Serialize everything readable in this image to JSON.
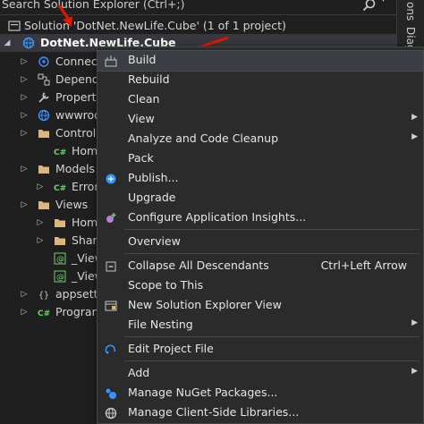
{
  "search": {
    "placeholder": "Search Solution Explorer (Ctrl+;)"
  },
  "dock": {
    "tabs": [
      "ons",
      "Diag"
    ]
  },
  "tree": {
    "solution": "Solution 'DotNet.NewLife.Cube' (1 of 1 project)",
    "project": "DotNet.NewLife.Cube",
    "items": [
      {
        "label": "Connect",
        "icon": "connected-services-icon"
      },
      {
        "label": "Depend",
        "icon": "dependencies-icon"
      },
      {
        "label": "Propert",
        "icon": "properties-icon"
      },
      {
        "label": "wwwroo",
        "icon": "globe-icon"
      },
      {
        "label": "Controll",
        "icon": "folder-icon"
      },
      {
        "label": "Hom",
        "icon": "csharp-file-icon"
      },
      {
        "label": "Models",
        "icon": "folder-icon"
      },
      {
        "label": "Error",
        "icon": "csharp-file-icon"
      },
      {
        "label": "Views",
        "icon": "folder-icon"
      },
      {
        "label": "Hom",
        "icon": "folder-icon"
      },
      {
        "label": "Share",
        "icon": "folder-icon"
      },
      {
        "label": "_View",
        "icon": "razor-file-icon"
      },
      {
        "label": "_View",
        "icon": "razor-file-icon"
      },
      {
        "label": "appsett",
        "icon": "json-file-icon"
      },
      {
        "label": "Program",
        "icon": "csharp-file-icon"
      }
    ]
  },
  "menu": {
    "items": [
      {
        "label": "Build",
        "icon": "build-icon",
        "highlighted": true
      },
      {
        "label": "Rebuild"
      },
      {
        "label": "Clean"
      },
      {
        "label": "View",
        "submenu": true
      },
      {
        "label": "Analyze and Code Cleanup",
        "submenu": true
      },
      {
        "label": "Pack"
      },
      {
        "label": "Publish...",
        "icon": "publish-icon"
      },
      {
        "label": "Upgrade"
      },
      {
        "label": "Configure Application Insights...",
        "icon": "insights-icon"
      },
      {
        "label": "Overview"
      },
      {
        "label": "Collapse All Descendants",
        "icon": "collapse-icon",
        "shortcut": "Ctrl+Left Arrow"
      },
      {
        "label": "Scope to This"
      },
      {
        "label": "New Solution Explorer View",
        "icon": "new-view-icon"
      },
      {
        "label": "File Nesting",
        "submenu": true
      },
      {
        "label": "Edit Project File",
        "icon": "edit-file-icon"
      },
      {
        "label": "Add",
        "submenu": true
      },
      {
        "label": "Manage NuGet Packages...",
        "icon": "nuget-icon"
      },
      {
        "label": "Manage Client-Side Libraries...",
        "icon": "client-libraries-icon"
      }
    ]
  },
  "colors": {
    "background": "#1f1f1f",
    "menu_bg": "#2b2b2b",
    "arrow": "#e51400",
    "accent": "#3794ff"
  }
}
